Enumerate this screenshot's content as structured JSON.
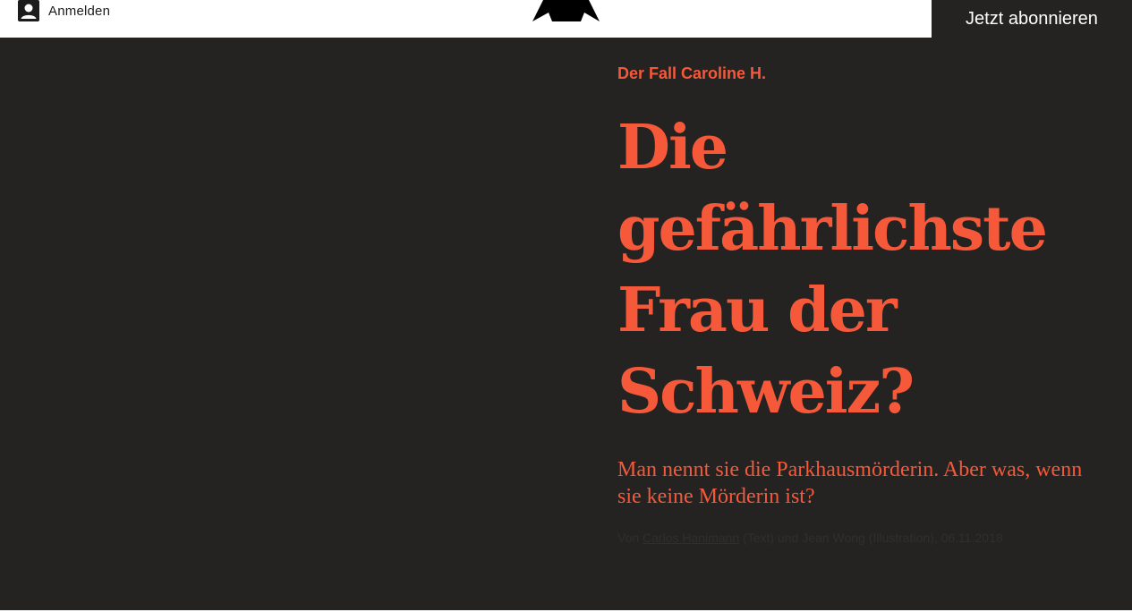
{
  "header": {
    "login_label": "Anmelden",
    "subscribe_label": "Jetzt abonnieren",
    "login_icon": "user-icon",
    "logo_icon": "republik-logo"
  },
  "article": {
    "kicker": "Der Fall Caroline H.",
    "title": "Die gefährlichste Frau der Schweiz?",
    "lead": "Man nennt sie die Parkhausmörderin. Aber was, wenn sie keine Mörderin ist?",
    "byline": {
      "prefix": "Von ",
      "author": "Carlos Hanimann",
      "suffix": " (Text) und Jean Wong (Illustration), 06.11.2018"
    }
  },
  "colors": {
    "accent": "#f5593a",
    "hero_background": "#242321",
    "header_background": "#ffffff",
    "subscribe_background": "#242321"
  }
}
